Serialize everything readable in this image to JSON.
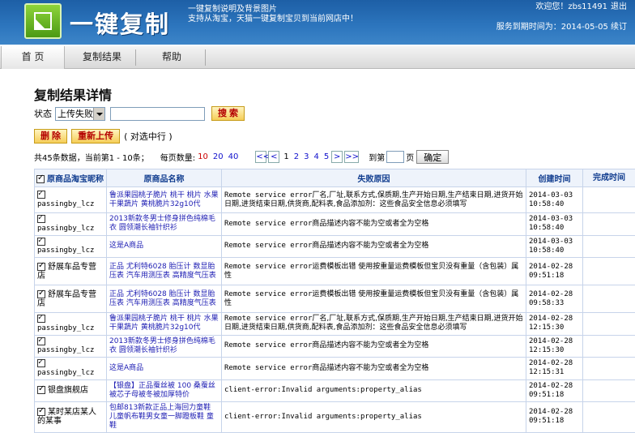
{
  "header": {
    "brand": "一键复制",
    "slogan_line1": "一键复制说明及背景图片",
    "slogan_line2": "支持从淘宝，天猫一键复制宝贝到当前网店中！",
    "welcome": "欢迎您！zbs11491",
    "logout": "退出",
    "expire": "服务到期时间为：2014-05-05 续订"
  },
  "nav": {
    "home": "首 页",
    "results": "复制结果",
    "help": "帮助"
  },
  "page_title": "复制结果详情",
  "filter": {
    "status_label": "状态",
    "status_value": "上传失败",
    "search_label": "搜 索"
  },
  "actions": {
    "delete": "删 除",
    "reupload": "重新上传",
    "hint": "( 对选中行 )"
  },
  "pager": {
    "summary": "共45条数据，当前第1 - 10条；",
    "page_size_label": "每页数量:",
    "sizes": [
      "10",
      "20",
      "40"
    ],
    "first": "<<",
    "prev": "<",
    "pages": [
      "1",
      "2",
      "3",
      "4",
      "5"
    ],
    "next": ">",
    "last": ">>",
    "jump_prefix": "到第",
    "jump_suffix": "页",
    "ok": "确定"
  },
  "table": {
    "headers": [
      "原商品淘宝昵称",
      "原商品名称",
      "失败原因",
      "创建时间",
      "完成时间"
    ],
    "rows": [
      {
        "nick": "passingby_lcz",
        "product": "鲁派果园桃子脆片 桃干 桃片 水果干果蔬片 黄桃脆片32g10代",
        "reason": "Remote service error厂名,厂址,联系方式,保质期,生产开始日期,生产结束日期,进货开始日期,进货结束日期,供货商,配料表,食品添加剂：这些食品安全信息必须填写",
        "created": "2014-03-03 10:58:40"
      },
      {
        "nick": "passingby_lcz",
        "product": "2013新款冬男士修身拼色纯棉毛衣 圆领潮长袖针织衫",
        "reason": "Remote service error商品描述内容不能为空或者全为空格",
        "created": "2014-03-03 10:58:40"
      },
      {
        "nick": "passingby_lcz",
        "product": "这是A商品",
        "reason": "Remote service error商品描述内容不能为空或者全为空格",
        "created": "2014-03-03 10:58:40"
      },
      {
        "nick": "舒展车品专营店",
        "product": "正品 尤利特6028 胎压计 数显胎压表 汽车用测压表 高精度气压表",
        "reason": "Remote service error运费模板出错 使用按重量运费模板但宝贝没有重量（含包装）属性",
        "created": "2014-02-28 09:51:18"
      },
      {
        "nick": "舒展车品专营店",
        "product": "正品 尤利特6028 胎压计 数显胎压表 汽车用测压表 高精度气压表",
        "reason": "Remote service error运费模板出错 使用按重量运费模板但宝贝没有重量（含包装）属性",
        "created": "2014-02-28 09:58:33"
      },
      {
        "nick": "passingby_lcz",
        "product": "鲁派果园桃子脆片 桃干 桃片 水果干果蔬片 黄桃脆片32g10代",
        "reason": "Remote service error厂名,厂址,联系方式,保质期,生产开始日期,生产结束日期,进货开始日期,进货结束日期,供货商,配料表,食品添加剂：这些食品安全信息必须填写",
        "created": "2014-02-28 12:15:30"
      },
      {
        "nick": "passingby_lcz",
        "product": "2013新款冬男士修身拼色纯棉毛衣 圆领潮长袖针织衫",
        "reason": "Remote service error商品描述内容不能为空或者全为空格",
        "created": "2014-02-28 12:15:30"
      },
      {
        "nick": "passingby_lcz",
        "product": "这是A商品",
        "reason": "Remote service error商品描述内容不能为空或者全为空格",
        "created": "2014-02-28 12:15:31"
      },
      {
        "nick": "银盘旗舰店",
        "product": "【银盘】正品蚕丝被 100 桑蚕丝被芯子母被冬被加厚特价",
        "reason": "client-error:Invalid arguments:property_alias",
        "created": "2014-02-28 09:51:18"
      },
      {
        "nick": "某时某店某人的某事",
        "product": "包邮813新款正品上海回力童鞋 儿童帆布鞋男女童一脚蹬板鞋 童鞋",
        "reason": "client-error:Invalid arguments:property_alias",
        "created": "2014-02-28 09:51:18"
      }
    ]
  }
}
